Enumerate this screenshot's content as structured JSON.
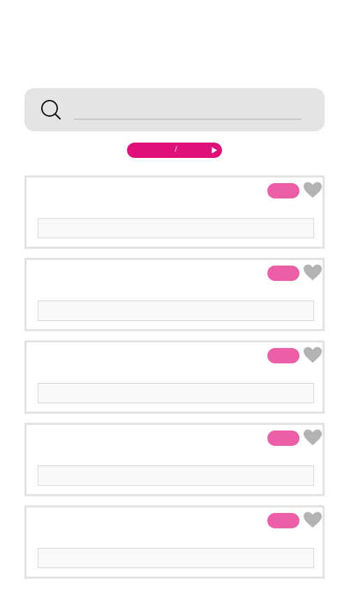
{
  "search": {
    "placeholder": "",
    "value": ""
  },
  "pager": {
    "current": "",
    "separator": "/",
    "total": "",
    "accent_color": "#e0107a"
  },
  "results": [
    {
      "title": "",
      "tag": "",
      "field": "",
      "favorited": false
    },
    {
      "title": "",
      "tag": "",
      "field": "",
      "favorited": false
    },
    {
      "title": "",
      "tag": "",
      "field": "",
      "favorited": false
    },
    {
      "title": "",
      "tag": "",
      "field": "",
      "favorited": false
    },
    {
      "title": "",
      "tag": "",
      "field": "",
      "favorited": false
    }
  ],
  "colors": {
    "tag": "#ec5fa7",
    "favorite_icon": "#b3b3b3",
    "search_background": "#e4e4e4"
  },
  "icons": {
    "search": "magnifier-icon",
    "favorite": "heart-icon",
    "next": "play-triangle-icon"
  }
}
